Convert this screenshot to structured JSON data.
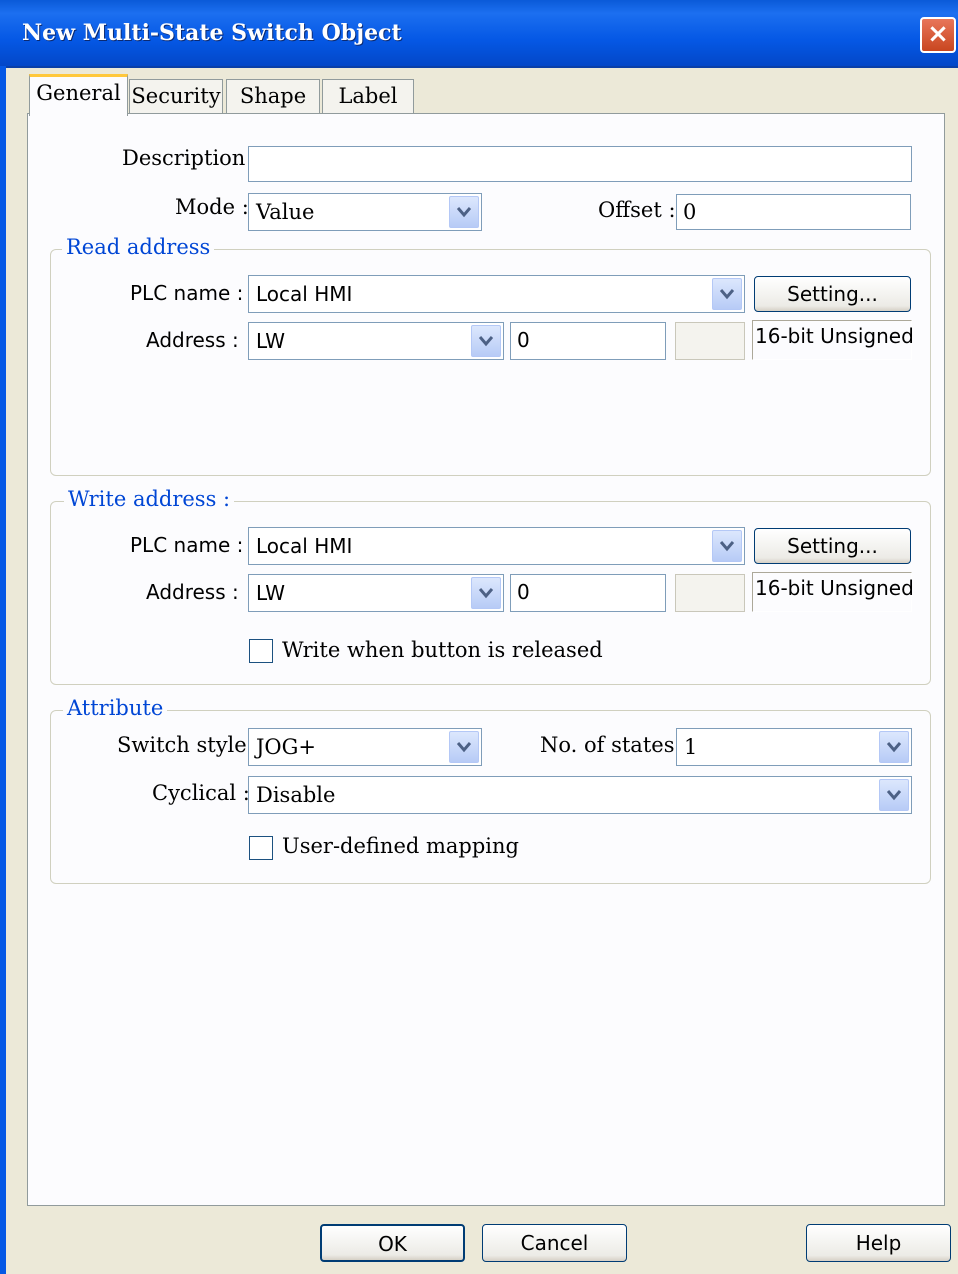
{
  "window": {
    "title": "New  Multi-State Switch Object",
    "close_icon": "×"
  },
  "tabs": [
    {
      "label": "General",
      "active": true
    },
    {
      "label": "Security",
      "active": false
    },
    {
      "label": "Shape",
      "active": false
    },
    {
      "label": "Label",
      "active": false
    }
  ],
  "general": {
    "description_label": "Description :",
    "description_value": "",
    "mode_label": "Mode :",
    "mode_value": "Value",
    "offset_label": "Offset :",
    "offset_value": "0"
  },
  "read_address": {
    "legend": "Read address",
    "plc_name_label": "PLC name :",
    "plc_name_value": "Local HMI",
    "setting_button": "Setting...",
    "address_label": "Address :",
    "device_value": "LW",
    "address_value": "0",
    "extra_value": "",
    "data_type": "16-bit Unsigned"
  },
  "write_address": {
    "legend": "Write address :",
    "plc_name_label": "PLC name :",
    "plc_name_value": "Local HMI",
    "setting_button": "Setting...",
    "address_label": "Address :",
    "device_value": "LW",
    "address_value": "0",
    "extra_value": "",
    "data_type": "16-bit Unsigned",
    "write_released_label": "Write when button is released",
    "write_released_checked": false
  },
  "attribute": {
    "legend": "Attribute",
    "switch_style_label": "Switch style :",
    "switch_style_value": "JOG+",
    "states_label": "No. of states :",
    "states_value": "1",
    "cyclical_label": "Cyclical :",
    "cyclical_value": "Disable",
    "mapping_label": "User-defined mapping",
    "mapping_checked": false
  },
  "footer": {
    "ok": "OK",
    "cancel": "Cancel",
    "help": "Help"
  },
  "colors": {
    "titlebar": "#0558e5",
    "legend_text": "#0046d5",
    "dialog_bg": "#ece9d8",
    "panel_bg": "#fcfcfe",
    "active_tab_highlight": "#ffc83c"
  }
}
